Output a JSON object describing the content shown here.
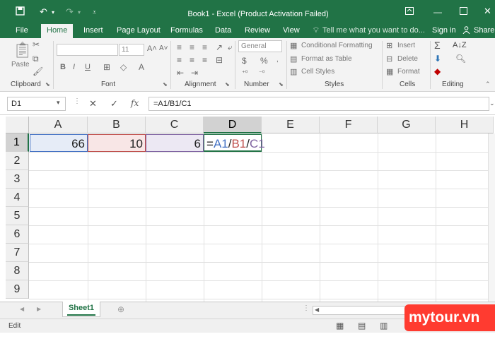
{
  "titlebar": {
    "title": "Book1 - Excel (Product Activation Failed)",
    "save_icon": "save-icon",
    "undo_icon": "undo-icon",
    "redo_icon": "redo-icon",
    "customize_icon": "customize-qat-icon"
  },
  "tabs": [
    "File",
    "Home",
    "Insert",
    "Page Layout",
    "Formulas",
    "Data",
    "Review",
    "View"
  ],
  "active_tab": "Home",
  "tell_me": "Tell me what you want to do...",
  "sign_in": "Sign in",
  "share": "Share",
  "ribbon": {
    "clipboard": {
      "label": "Clipboard",
      "paste": "Paste"
    },
    "font": {
      "label": "Font",
      "size": "11",
      "bold": "B",
      "italic": "I",
      "underline": "U"
    },
    "alignment": {
      "label": "Alignment"
    },
    "number": {
      "label": "Number",
      "format": "General",
      "currency": "$",
      "percent": "%"
    },
    "styles": {
      "label": "Styles",
      "conditional": "Conditional Formatting",
      "format_table": "Format as Table",
      "cell_styles": "Cell Styles"
    },
    "cells": {
      "label": "Cells",
      "insert": "Insert",
      "delete": "Delete",
      "format": "Format"
    },
    "editing": {
      "label": "Editing"
    }
  },
  "formula_bar": {
    "name_box": "D1",
    "formula": "=A1/B1/C1",
    "fx": "fx"
  },
  "columns": [
    "A",
    "B",
    "C",
    "D",
    "E",
    "F",
    "G",
    "H"
  ],
  "rows": [
    "1",
    "2",
    "3",
    "4",
    "5",
    "6",
    "7",
    "8",
    "9"
  ],
  "cells": {
    "A1": "66",
    "B1": "10",
    "C1": "6"
  },
  "edit_formula": {
    "eq": "=",
    "a": "A1",
    "s1": "/",
    "b": "B1",
    "s2": "/",
    "c": "C1"
  },
  "ref_colors": {
    "A1": "#4472c4",
    "B1": "#c0504d",
    "C1": "#8064a2"
  },
  "sheet_tab": "Sheet1",
  "status": "Edit",
  "watermark": "mytour.vn",
  "accent": "#217346"
}
